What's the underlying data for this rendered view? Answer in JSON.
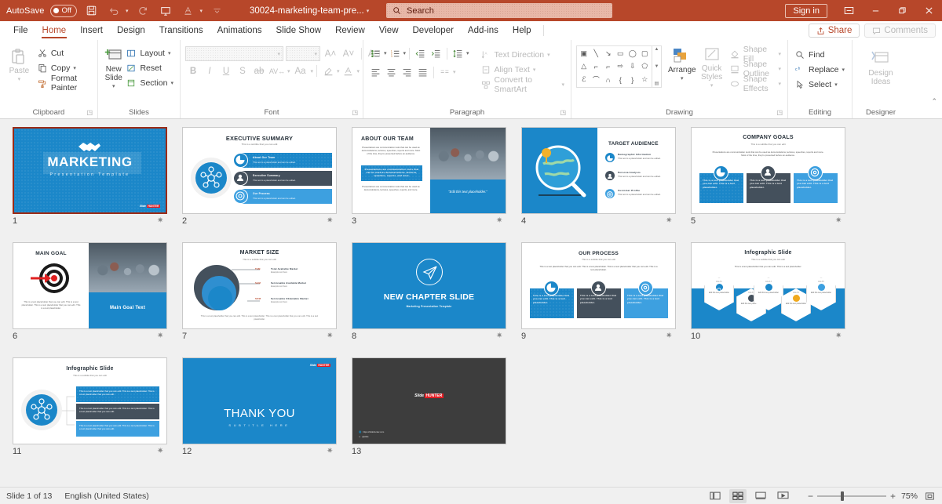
{
  "titlebar": {
    "autosave_label": "AutoSave",
    "autosave_state": "Off",
    "document_title": "30024-marketing-team-pre...",
    "search_placeholder": "Search",
    "signin_label": "Sign in",
    "icons": {
      "save": "save-icon",
      "undo": "undo-icon",
      "redo": "redo-icon",
      "present": "start-presentation-icon",
      "touch": "touch-mode-icon",
      "more": "customize-quick-access-icon",
      "ribbon_display": "ribbon-display-options-icon",
      "minimize": "minimize-icon",
      "restore": "restore-icon",
      "close": "close-icon"
    },
    "accent_color": "#b7472a"
  },
  "menubar": {
    "items": [
      {
        "label": "File",
        "active": false
      },
      {
        "label": "Home",
        "active": true
      },
      {
        "label": "Insert",
        "active": false
      },
      {
        "label": "Design",
        "active": false
      },
      {
        "label": "Transitions",
        "active": false
      },
      {
        "label": "Animations",
        "active": false
      },
      {
        "label": "Slide Show",
        "active": false
      },
      {
        "label": "Review",
        "active": false
      },
      {
        "label": "View",
        "active": false
      },
      {
        "label": "Developer",
        "active": false
      },
      {
        "label": "Add-ins",
        "active": false
      },
      {
        "label": "Help",
        "active": false
      }
    ],
    "share_label": "Share",
    "comments_label": "Comments"
  },
  "ribbon": {
    "groups": [
      {
        "name": "Clipboard",
        "label": "Clipboard",
        "paste_label": "Paste",
        "items": [
          {
            "label": "Cut",
            "icon": "scissors-icon"
          },
          {
            "label": "Copy",
            "icon": "copy-icon"
          },
          {
            "label": "Format Painter",
            "icon": "format-painter-icon"
          }
        ]
      },
      {
        "name": "Slides",
        "label": "Slides",
        "new_slide_label": "New Slide",
        "items": [
          {
            "label": "Layout",
            "icon": "layout-icon"
          },
          {
            "label": "Reset",
            "icon": "reset-icon"
          },
          {
            "label": "Section",
            "icon": "section-icon"
          }
        ]
      },
      {
        "name": "Font",
        "label": "Font",
        "font_name_value": "",
        "font_size_value": ""
      },
      {
        "name": "Paragraph",
        "label": "Paragraph",
        "items": [
          {
            "label": "Text Direction",
            "icon": "text-direction-icon"
          },
          {
            "label": "Align Text",
            "icon": "align-text-icon"
          },
          {
            "label": "Convert to SmartArt",
            "icon": "convert-to-smartart-icon"
          }
        ]
      },
      {
        "name": "Drawing",
        "label": "Drawing",
        "arrange_label": "Arrange",
        "quick_styles_label": "Quick Styles",
        "items": [
          {
            "label": "Shape Fill",
            "icon": "shape-fill-icon"
          },
          {
            "label": "Shape Outline",
            "icon": "shape-outline-icon"
          },
          {
            "label": "Shape Effects",
            "icon": "shape-effects-icon"
          }
        ]
      },
      {
        "name": "Editing",
        "label": "Editing",
        "items": [
          {
            "label": "Find",
            "icon": "find-icon"
          },
          {
            "label": "Replace",
            "icon": "replace-icon"
          },
          {
            "label": "Select",
            "icon": "select-icon"
          }
        ]
      },
      {
        "name": "Designer",
        "label": "Designer",
        "design_ideas_label": "Design Ideas"
      }
    ]
  },
  "slides": [
    {
      "number": "1",
      "selected": true,
      "kind": "title",
      "title": "MARKETING",
      "subtitle": "Presentation Template",
      "logo": "Slide HUNTER"
    },
    {
      "number": "2",
      "selected": false,
      "kind": "exec-summary",
      "title": "EXECUTIVE SUMMARY",
      "subtitle": "This is a subtitle that you can edit",
      "rows": [
        {
          "heading": "About Our Team",
          "text": "This text is a placeholder and can be edited."
        },
        {
          "heading": "Executive Summary",
          "text": "This text is a placeholder and can be edited."
        },
        {
          "heading": "Our Process",
          "text": "This text is a placeholder and can be edited."
        }
      ]
    },
    {
      "number": "3",
      "selected": false,
      "kind": "about-team",
      "title": "ABOUT OUR TEAM",
      "body": "Presentations are communication tools that can be used as demonstrations, lectures, speeches, reports and more. Most of the time, they're presented before an audience.",
      "highlight": "Presentations are communication tools that can be used as demonstrations, lectures, speeches, reports, and more.",
      "body2": "Presentations are communication tools that can be used as demonstrations, lectures, speeches, reports, and more.",
      "caption": "\"Edit this text placeholder.\""
    },
    {
      "number": "4",
      "selected": false,
      "kind": "target-audience",
      "title": "TARGET AUDIENCE",
      "rows": [
        {
          "heading": "Demographic Information",
          "text": "This text is a placeholder and can be edited."
        },
        {
          "heading": "Persona Analysis",
          "text": "This text is a placeholder and can be edited."
        },
        {
          "heading": "Customer Profile",
          "text": "This text is a placeholder and can be edited."
        }
      ]
    },
    {
      "number": "5",
      "selected": false,
      "kind": "three-cards",
      "title": "COMPANY GOALS",
      "subtitle": "This is a subtitle that you can edit",
      "body": "Presentations are communication tools that can be used as demonstrations, lectures, speeches, reports and more. Most of the time, they're presented before an audience.",
      "cards": [
        {
          "text": "This is a text placeholder that you can edit. This is a text placeholder."
        },
        {
          "text": "This is a text placeholder that you can edit. This is a text placeholder."
        },
        {
          "text": "This is a text placeholder that you can edit. This is a text placeholder."
        }
      ]
    },
    {
      "number": "6",
      "selected": false,
      "kind": "main-goal",
      "title": "MAIN GOAL",
      "body": "This is a text placeholder that you can edit. This is a text placeholder. This is a text placeholder that you can edit. This is a text placeholder.",
      "panel_text": "Main Goal Text"
    },
    {
      "number": "7",
      "selected": false,
      "kind": "market-size",
      "title": "MARKET SIZE",
      "subtitle": "This is a subtitle that you can edit",
      "rows": [
        {
          "tag": "TAM",
          "heading": "Total Available Market",
          "text": "Example text here"
        },
        {
          "tag": "SAM",
          "heading": "Serviceable Available Market",
          "text": "Example text here"
        },
        {
          "tag": "SOM",
          "heading": "Serviceable Obtainable Market",
          "text": "Example text here"
        }
      ],
      "footer": "This is a text placeholder that you can edit. This is a text placeholder. This is a text placeholder that you can edit. This is a text placeholder."
    },
    {
      "number": "8",
      "selected": false,
      "kind": "chapter",
      "title": "NEW CHAPTER SLIDE",
      "subtitle": "Marketing Presentation Template"
    },
    {
      "number": "9",
      "selected": false,
      "kind": "three-cards",
      "title": "OUR PROCESS",
      "subtitle": "This is a subtitle that you can edit",
      "body": "This is a text placeholder that you can edit. This is a text placeholder. This is a text placeholder that you can edit. This is a text placeholder.",
      "cards": [
        {
          "text": "This is a text placeholder that you can edit. This is a text placeholder."
        },
        {
          "text": "This is a text placeholder that you can edit. This is a text placeholder."
        },
        {
          "text": "This is a text placeholder that you can edit. This is a text placeholder."
        }
      ]
    },
    {
      "number": "10",
      "selected": false,
      "kind": "hexagons",
      "title": "Infographic Slide",
      "subtitle": "This is a subtitle that you can edit",
      "body": "This is a text placeholder that you can edit. This is a text placeholder.",
      "nodes": [
        {
          "tag": "Info # 1",
          "text": "Edit this text placeholder"
        },
        {
          "tag": "Info # 2",
          "text": "Edit this text placeholder"
        },
        {
          "tag": "Info # 3",
          "text": "Edit this text placeholder"
        },
        {
          "tag": "Info # 4",
          "text": "Edit this text placeholder"
        },
        {
          "tag": "Info # 5",
          "text": "Edit this text placeholder"
        }
      ]
    },
    {
      "number": "11",
      "selected": false,
      "kind": "infographic-bars",
      "title": "Infographic Slide",
      "subtitle": "This is a subtitle that you can edit",
      "rows": [
        {
          "text": "This is a text placeholder that you can edit. This is a text placeholder. This is a text placeholder that you can edit."
        },
        {
          "text": "This is a text placeholder that you can edit. This is a text placeholder. This is a text placeholder that you can edit."
        },
        {
          "text": "This is a text placeholder that you can edit. This is a text placeholder. This is a text placeholder that you can edit."
        }
      ]
    },
    {
      "number": "12",
      "selected": false,
      "kind": "thank-you",
      "title": "THANK YOU",
      "subtitle": "SUBTITLE HERE",
      "logo": "Slide HUNTER"
    },
    {
      "number": "13",
      "selected": false,
      "kind": "credits",
      "logo": "Slide HUNTER",
      "link1": "https://slidehunter.com",
      "link2": "@slide"
    }
  ],
  "statusbar": {
    "slide_indicator": "Slide 1 of 13",
    "language": "English (United States)",
    "views": [
      {
        "name": "normal-view",
        "active": false
      },
      {
        "name": "slide-sorter-view",
        "active": true
      },
      {
        "name": "reading-view",
        "active": false
      },
      {
        "name": "slide-show-view",
        "active": false
      }
    ],
    "zoom_out": "−",
    "zoom_in": "+",
    "zoom_level": "75%"
  }
}
